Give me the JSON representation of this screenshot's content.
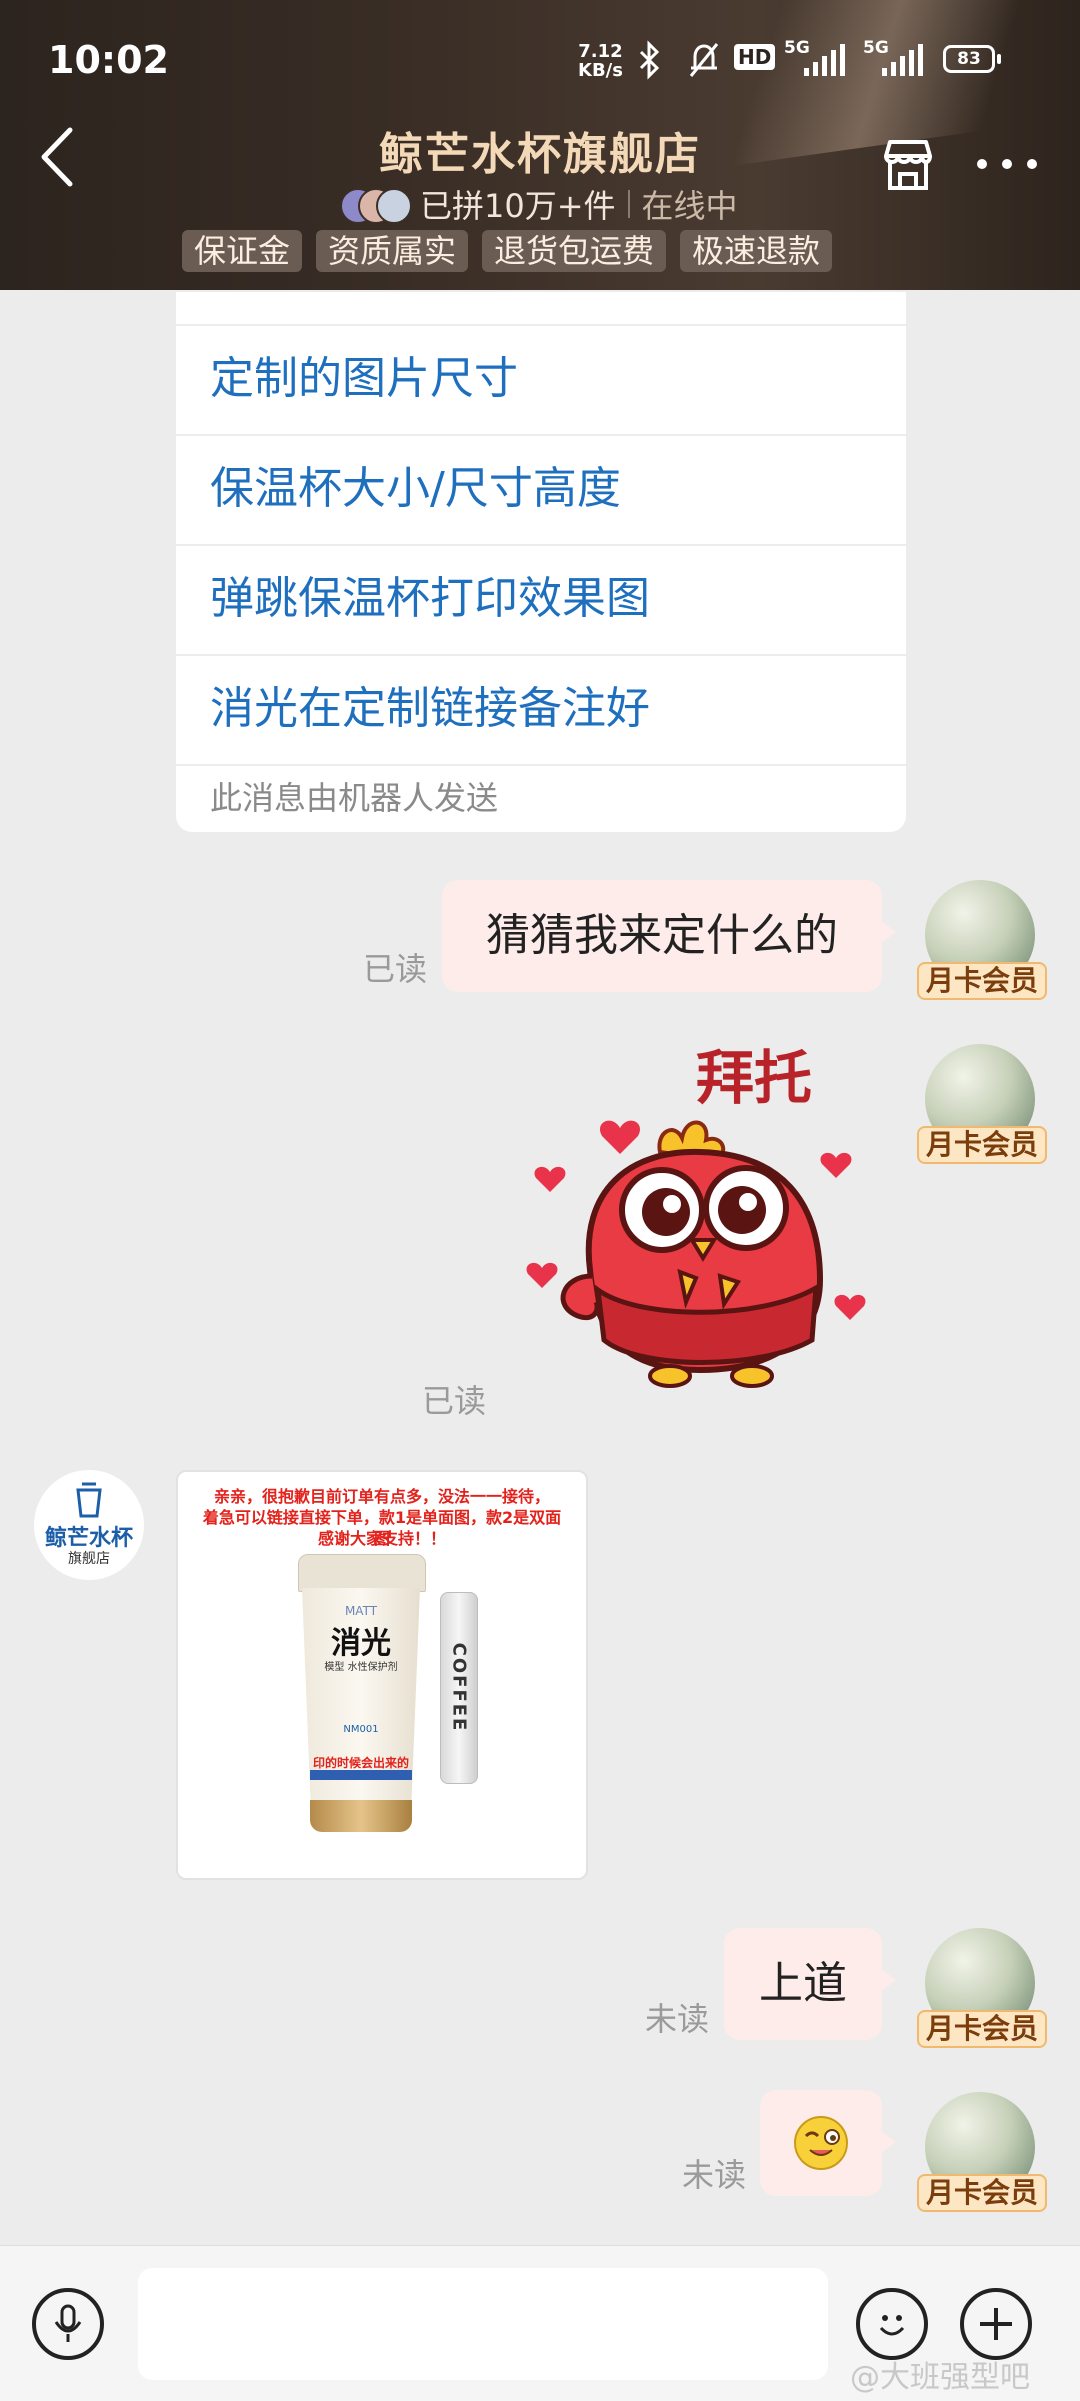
{
  "status_bar": {
    "time": "10:02",
    "net_speed_top": "7.12",
    "net_speed_bottom": "KB/s",
    "hd_label": "HD",
    "sim1": "5G",
    "sim2": "5G",
    "battery": "83"
  },
  "header": {
    "title": "鲸芒水杯旗舰店",
    "sold": "已拼10万+件",
    "online": "在线中",
    "tags": [
      "保证金",
      "资质属实",
      "退货包运费",
      "极速退款"
    ]
  },
  "robot_card": {
    "questions": [
      "定制的图片尺寸",
      "保温杯大小/尺寸高度",
      "弹跳保温杯打印效果图",
      "消光在定制链接备注好"
    ],
    "note": "此消息由机器人发送"
  },
  "messages": {
    "m1": {
      "text": "猜猜我来定什么的",
      "status": "已读"
    },
    "m2": {
      "sticker_text": "拜托",
      "status": "已读"
    },
    "m3": {
      "image_lines": [
        "亲亲，很抱歉目前订单有点多，没法一一接待，",
        "着急可以链接直接下单，款1是单面图，款2是双面图",
        "感谢大家支持！！"
      ],
      "cup_brand": "MATT",
      "cup_title": "消光",
      "cup_sub": "模型 水性保护剂",
      "cup_code": "NM001",
      "cup_red": "印的时候会出来的",
      "strap_text": "COFFEE"
    },
    "m4": {
      "text": "上道",
      "status": "未读"
    },
    "m5": {
      "status": "未读"
    }
  },
  "member_badge": "月卡会员",
  "shop_avatar": {
    "name": "鲸芒水杯",
    "sub": "旗舰店"
  },
  "watermark": "@大班强型吧",
  "colors": {
    "header_bg": "#3a2e26",
    "title_gold": "#f4d9b8",
    "link_blue": "#1f6fbf",
    "bubble_pink": "#fdecea",
    "badge_bg": "#fde6c4"
  }
}
